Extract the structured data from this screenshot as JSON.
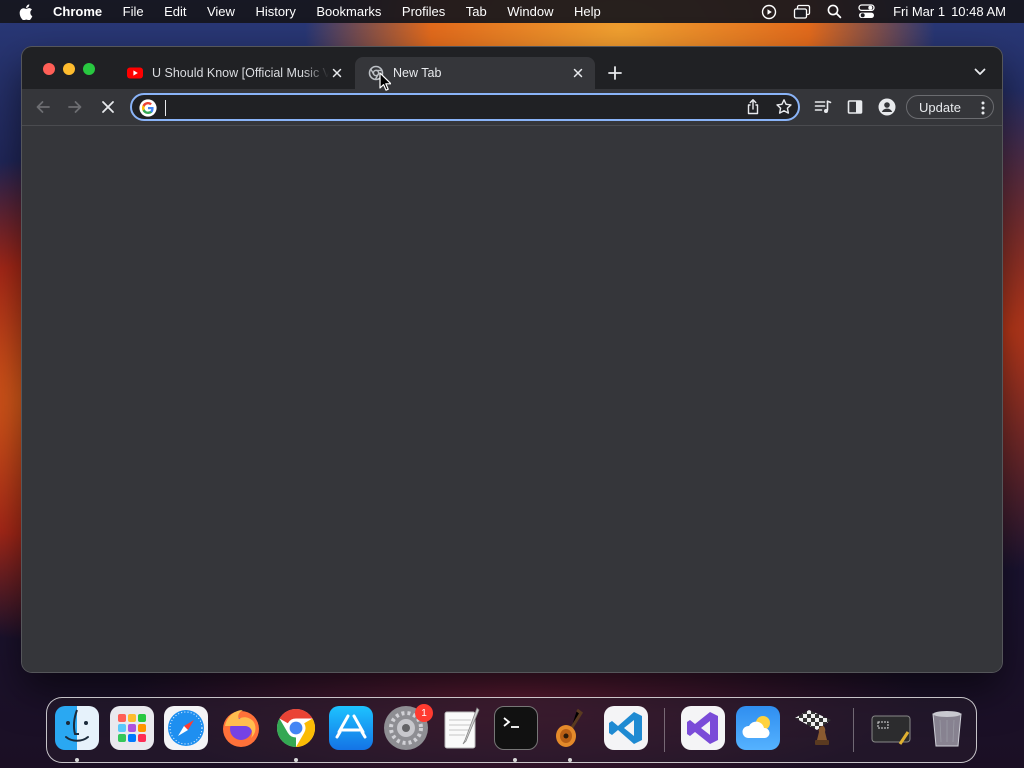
{
  "menubar": {
    "app_name": "Chrome",
    "items": [
      "File",
      "Edit",
      "View",
      "History",
      "Bookmarks",
      "Profiles",
      "Tab",
      "Window",
      "Help"
    ],
    "date": "Fri Mar 1",
    "time": "10:48 AM"
  },
  "browser": {
    "tabs": [
      {
        "title": "U Should Know [Official Music Video]",
        "favicon": "youtube-icon",
        "active": false
      },
      {
        "title": "New Tab",
        "favicon": "chrome-icon",
        "active": true
      }
    ],
    "omnibox": {
      "value": "",
      "placeholder": ""
    },
    "update_label": "Update",
    "accent_color": "#8ab4f8"
  },
  "dock": {
    "apps": [
      {
        "name": "Finder",
        "running": true
      },
      {
        "name": "Launchpad",
        "running": false
      },
      {
        "name": "Safari",
        "running": false
      },
      {
        "name": "Firefox",
        "running": false
      },
      {
        "name": "Google Chrome",
        "running": true
      },
      {
        "name": "App Store",
        "running": false
      },
      {
        "name": "System Settings",
        "running": false,
        "badge": "1"
      },
      {
        "name": "TextEdit",
        "running": false
      },
      {
        "name": "Terminal",
        "running": true
      },
      {
        "name": "GarageBand",
        "running": true
      },
      {
        "name": "Visual Studio Code",
        "running": false
      },
      {
        "name": "Visual Studio",
        "running": false
      },
      {
        "name": "Weather",
        "running": false
      },
      {
        "name": "Chess",
        "running": false
      },
      {
        "name": "Screenshot",
        "running": false
      },
      {
        "name": "Trash",
        "running": false
      }
    ]
  }
}
